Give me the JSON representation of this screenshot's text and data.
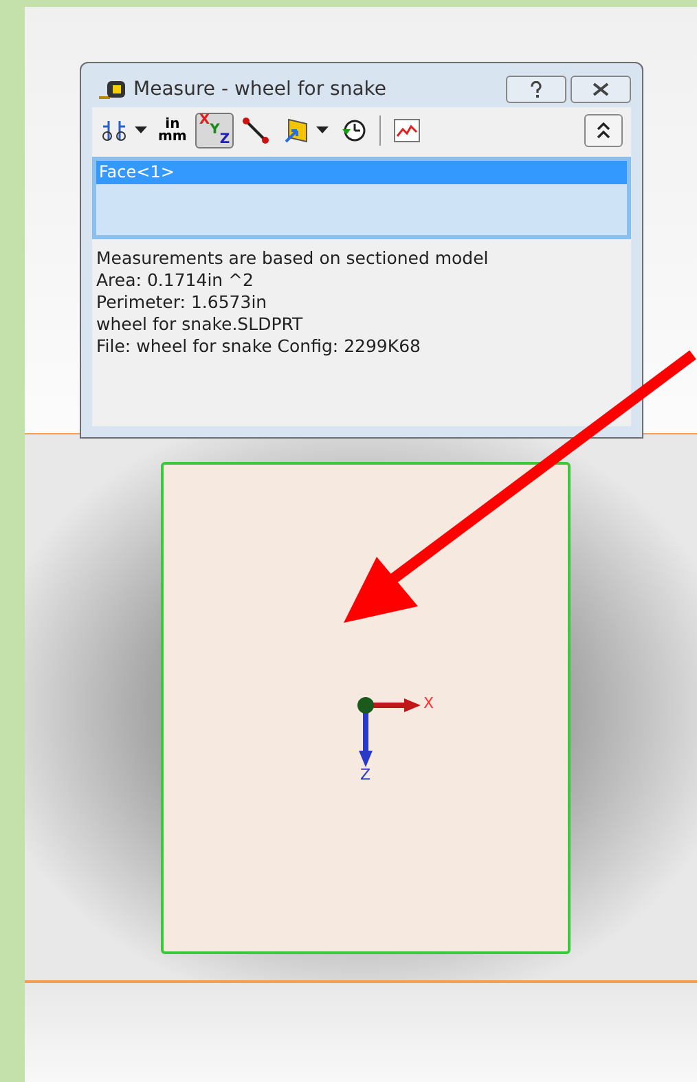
{
  "dialog": {
    "title": "Measure - wheel for snake",
    "toolbar": [
      {
        "kind": "dimension",
        "selected": false
      },
      {
        "kind": "units",
        "top": "in",
        "bottom": "mm",
        "selected": false
      },
      {
        "kind": "xyz",
        "x": "X",
        "y": "Y",
        "z": "Z",
        "selected": true
      },
      {
        "kind": "point",
        "selected": false
      },
      {
        "kind": "plane",
        "selected": false
      },
      {
        "kind": "history",
        "selected": false
      },
      {
        "kind": "separator"
      },
      {
        "kind": "graph",
        "selected": false
      }
    ],
    "selections": [
      {
        "label": "Face<1>",
        "selected": true
      }
    ],
    "results": [
      "Measurements are based on sectioned model",
      "Area: 0.1714in ^2",
      "Perimeter: 1.6573in",
      "wheel for snake.SLDPRT",
      "File: wheel for snake Config: 2299K68"
    ]
  },
  "triad": {
    "x_label": "X",
    "z_label": "Z"
  }
}
